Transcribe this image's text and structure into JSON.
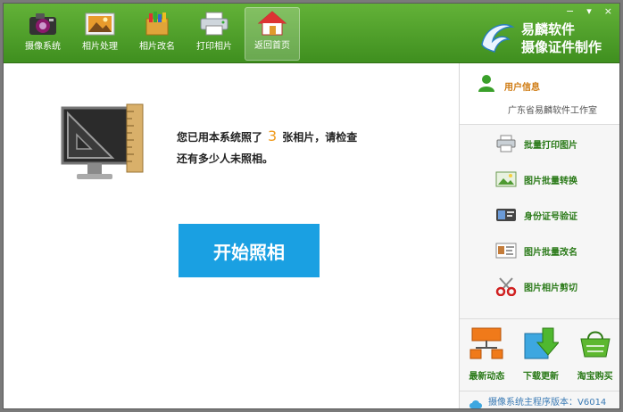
{
  "toolbar": {
    "items": [
      {
        "label": "摄像系统",
        "icon": "camera-icon"
      },
      {
        "label": "相片处理",
        "icon": "photo-edit-icon"
      },
      {
        "label": "相片改名",
        "icon": "rename-icon"
      },
      {
        "label": "打印相片",
        "icon": "printer-icon"
      },
      {
        "label": "返回首页",
        "icon": "home-icon"
      }
    ],
    "active_index": 4,
    "window_controls": [
      "−",
      "▾",
      "×"
    ]
  },
  "brand": {
    "line1": "易麟软件",
    "line2": "摄像证件制作"
  },
  "main": {
    "message_part1": "您已用本系统照了",
    "count": "3",
    "message_part2": "张相片，请检查",
    "message_line2": "还有多少人未照相。",
    "start_button": "开始照相"
  },
  "sidebar": {
    "user_title": "用户信息",
    "user_name": "广东省易麟软件工作室",
    "items": [
      {
        "label": "批量打印图片",
        "icon": "batch-print-icon"
      },
      {
        "label": "图片批量转换",
        "icon": "image-convert-icon"
      },
      {
        "label": "身份证号验证",
        "icon": "id-card-icon"
      },
      {
        "label": "图片批量改名",
        "icon": "batch-rename-icon"
      },
      {
        "label": "图片相片剪切",
        "icon": "scissors-icon"
      }
    ],
    "bottom": [
      {
        "label": "最新动态",
        "icon": "news-icon"
      },
      {
        "label": "下载更新",
        "icon": "download-icon"
      },
      {
        "label": "淘宝购买",
        "icon": "cart-icon"
      }
    ],
    "version": "摄像系统主程序版本：V6014"
  },
  "colors": {
    "toolbar_green": "#4ea12a",
    "start_button_blue": "#1aa0e2",
    "count_orange": "#f09a1a",
    "sidebar_text_green": "#2a7a18"
  }
}
